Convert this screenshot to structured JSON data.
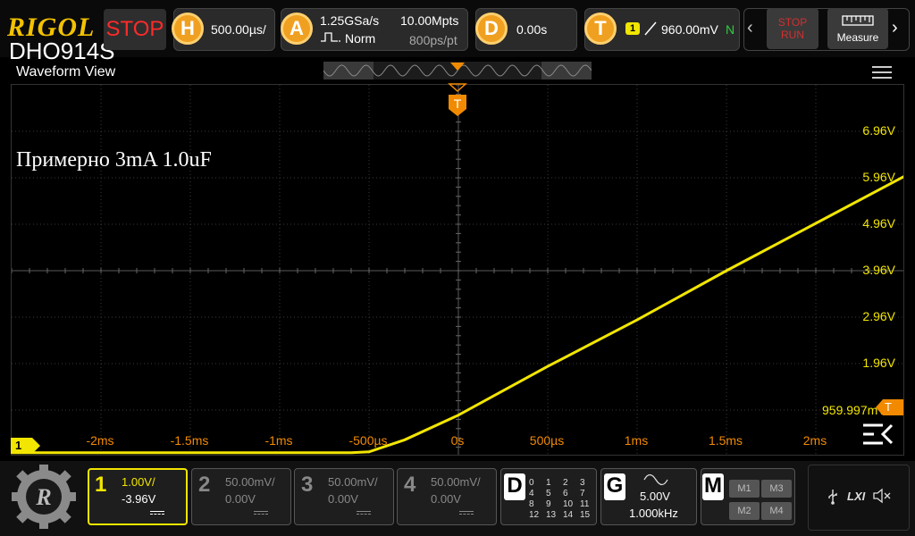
{
  "header": {
    "brand": "RIGOL",
    "model": "DHO914S",
    "run_state": "STOP",
    "horizontal": {
      "badge": "H",
      "timebase": "500.00µs/"
    },
    "acquire": {
      "badge": "A",
      "sample_rate": "1.25GSa/s",
      "mode": "Norm",
      "memory": "10.00Mpts",
      "resolution": "800ps/pt"
    },
    "delay": {
      "badge": "D",
      "value": "0.00s"
    },
    "trigger": {
      "badge": "T",
      "channel": "1",
      "level": "960.00mV",
      "status": "N"
    },
    "stop_run": {
      "stop": "STOP",
      "run": "RUN"
    },
    "measure_label": "Measure"
  },
  "waveform": {
    "title": "Waveform View",
    "annotation": "Примерно 3mA 1.0uF",
    "trigger_marker": "T",
    "channel_marker": "1",
    "trigger_level_readout": "959.997mV",
    "trigger_level_marker": "T",
    "volt_labels": [
      "6.96V",
      "5.96V",
      "4.96V",
      "3.96V",
      "2.96V",
      "1.96V"
    ],
    "time_labels": [
      "-2ms",
      "-1.5ms",
      "-1ms",
      "-500µs",
      "0s",
      "500µs",
      "1ms",
      "1.5ms",
      "2ms"
    ]
  },
  "chart_data": {
    "type": "line",
    "title": "",
    "xlabel": "",
    "ylabel": "",
    "xlim": [
      -2.5,
      2.5
    ],
    "ylim": [
      -0.04,
      7.96
    ],
    "x_unit": "ms",
    "y_unit": "V",
    "series": [
      {
        "x": [
          -2.5,
          -0.6,
          -0.5,
          -0.3,
          0.0,
          0.5,
          1.0,
          1.5,
          2.0,
          2.5
        ],
        "y": [
          0.04,
          0.04,
          0.06,
          0.32,
          0.85,
          1.9,
          2.9,
          3.96,
          4.98,
          6.0
        ]
      }
    ],
    "grid": true,
    "color": "#f2e600"
  },
  "channels": [
    {
      "num": "1",
      "scale": "1.00V/",
      "offset": "-3.96V",
      "active": true
    },
    {
      "num": "2",
      "scale": "50.00mV/",
      "offset": "0.00V",
      "active": false
    },
    {
      "num": "3",
      "scale": "50.00mV/",
      "offset": "0.00V",
      "active": false
    },
    {
      "num": "4",
      "scale": "50.00mV/",
      "offset": "0.00V",
      "active": false
    }
  ],
  "digital": {
    "badge": "D",
    "bits": [
      "0",
      "1",
      "2",
      "3",
      "4",
      "5",
      "6",
      "7",
      "8",
      "9",
      "10",
      "11",
      "12",
      "13",
      "14",
      "15"
    ]
  },
  "generator": {
    "badge": "G",
    "amplitude": "5.00V",
    "frequency": "1.000kHz"
  },
  "math": {
    "badge": "M",
    "items": [
      "M1",
      "M3",
      "M2",
      "M4"
    ]
  },
  "status_icons": {
    "lxi": "LXI"
  },
  "colors": {
    "ch1": "#f2e600",
    "trigger": "#f28a00",
    "stop": "#ff2a2a",
    "brand": "#f2c200"
  }
}
